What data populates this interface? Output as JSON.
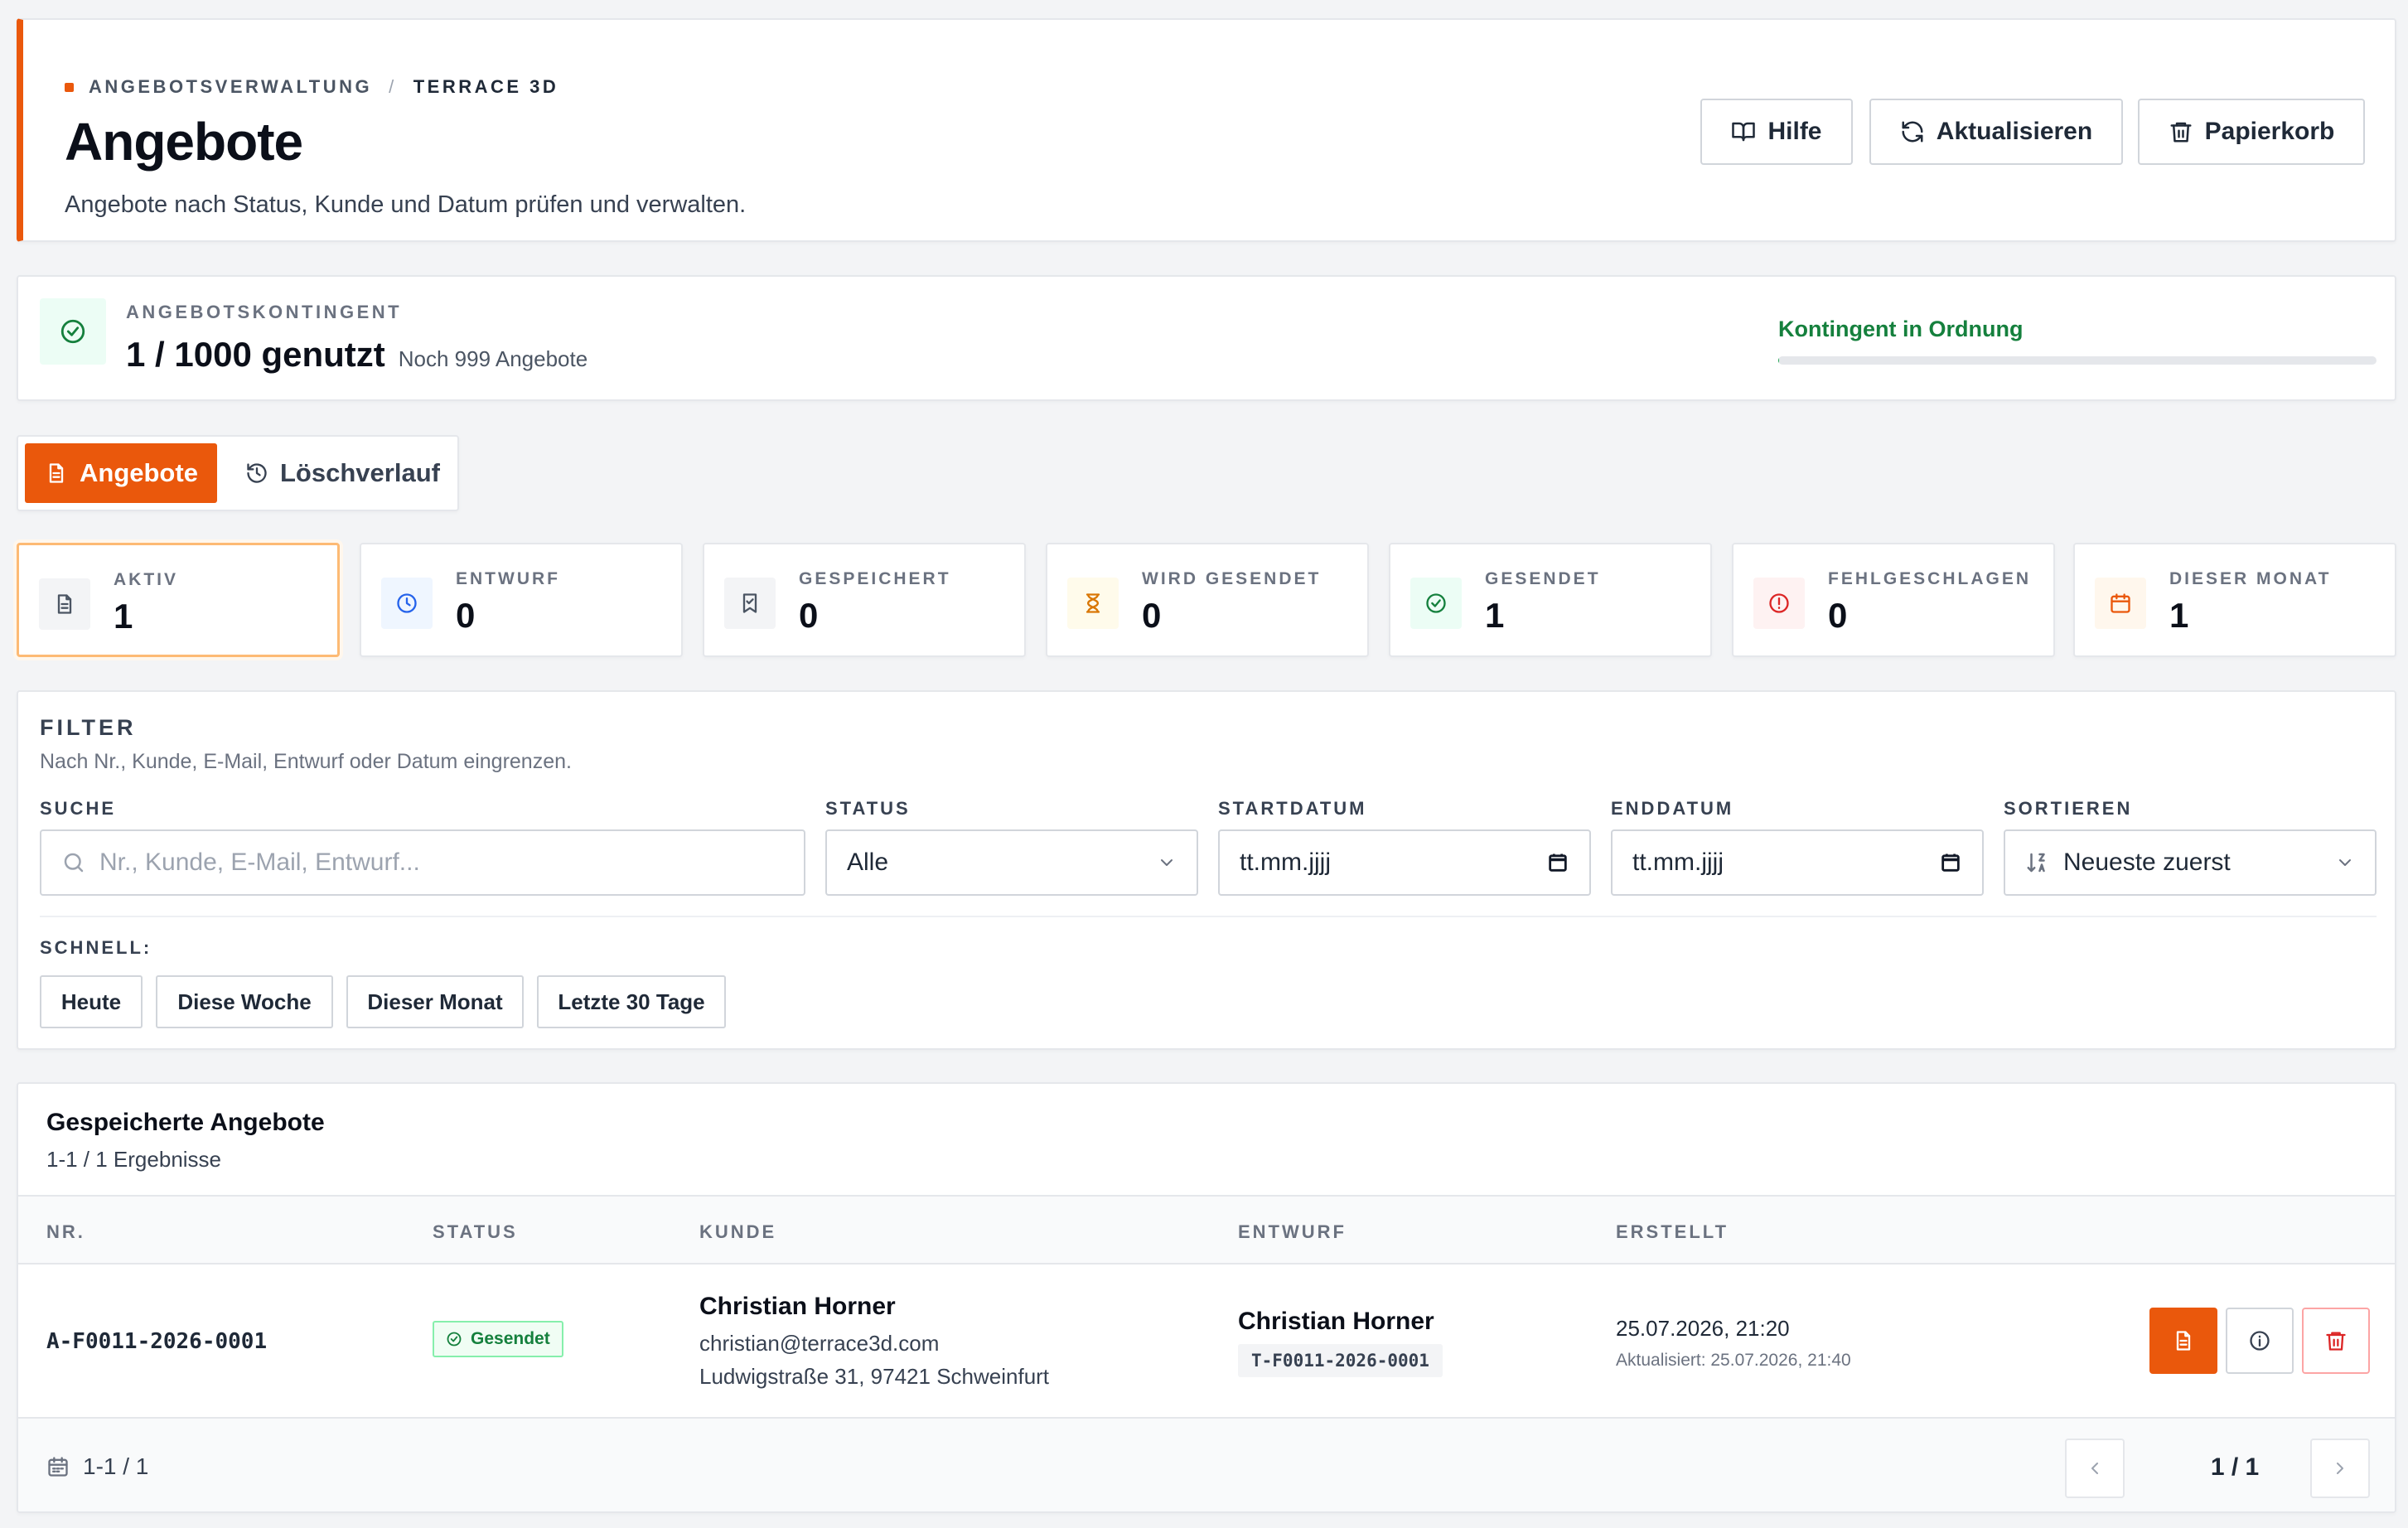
{
  "header": {
    "breadcrumb_root": "ANGEBOTSVERWALTUNG",
    "breadcrumb_separator": "/",
    "breadcrumb_current": "TERRACE 3D",
    "title": "Angebote",
    "subtitle": "Angebote nach Status, Kunde und Datum prüfen und verwalten.",
    "buttons": {
      "help": "Hilfe",
      "refresh": "Aktualisieren",
      "trash": "Papierkorb"
    }
  },
  "quota": {
    "label": "ANGEBOTSKONTINGENT",
    "value": "1 / 1000 genutzt",
    "remaining": "Noch 999 Angebote",
    "status": "Kontingent in Ordnung",
    "used_fraction": 0.001
  },
  "tabs": {
    "offers": "Angebote",
    "history": "Löschverlauf"
  },
  "stats": [
    {
      "label": "AKTIV",
      "value": "1",
      "icon": "document-icon"
    },
    {
      "label": "ENTWURF",
      "value": "0",
      "icon": "clock-icon"
    },
    {
      "label": "GESPEICHERT",
      "value": "0",
      "icon": "bookmark-icon"
    },
    {
      "label": "WIRD GESENDET",
      "value": "0",
      "icon": "hourglass-icon"
    },
    {
      "label": "GESENDET",
      "value": "1",
      "icon": "check-circle-icon"
    },
    {
      "label": "FEHLGESCHLAGEN",
      "value": "0",
      "icon": "alert-circle-icon"
    },
    {
      "label": "DIESER MONAT",
      "value": "1",
      "icon": "calendar-icon"
    }
  ],
  "filter": {
    "title": "FILTER",
    "subtitle": "Nach Nr., Kunde, E-Mail, Entwurf oder Datum eingrenzen.",
    "search_label": "SUCHE",
    "search_placeholder": "Nr., Kunde, E-Mail, Entwurf...",
    "status_label": "STATUS",
    "status_value": "Alle",
    "start_label": "STARTDATUM",
    "start_placeholder": "tt.mm.jjjj",
    "end_label": "ENDDATUM",
    "end_placeholder": "tt.mm.jjjj",
    "sort_label": "SORTIEREN",
    "sort_value": "Neueste zuerst",
    "quick_label": "SCHNELL:",
    "quick": [
      "Heute",
      "Diese Woche",
      "Dieser Monat",
      "Letzte 30 Tage"
    ]
  },
  "table": {
    "title": "Gespeicherte Angebote",
    "count": "1-1 / 1 Ergebnisse",
    "columns": [
      "NR.",
      "STATUS",
      "KUNDE",
      "ENTWURF",
      "ERSTELLT"
    ],
    "rows": [
      {
        "nr": "A-F0011-2026-0001",
        "status": "Gesendet",
        "customer_name": "Christian Horner",
        "customer_email": "christian@terrace3d.com",
        "customer_address": "Ludwigstraße 31, 97421 Schweinfurt",
        "draft_name": "Christian Horner",
        "draft_code": "T-F0011-2026-0001",
        "created": "25.07.2026, 21:20",
        "updated": "Aktualisiert: 25.07.2026, 21:40"
      }
    ],
    "footer_range": "1-1 / 1",
    "page": "1 / 1"
  },
  "colors": {
    "accent": "#ea580c",
    "success": "#15803d",
    "danger": "#dc2626",
    "info": "#2563eb"
  }
}
